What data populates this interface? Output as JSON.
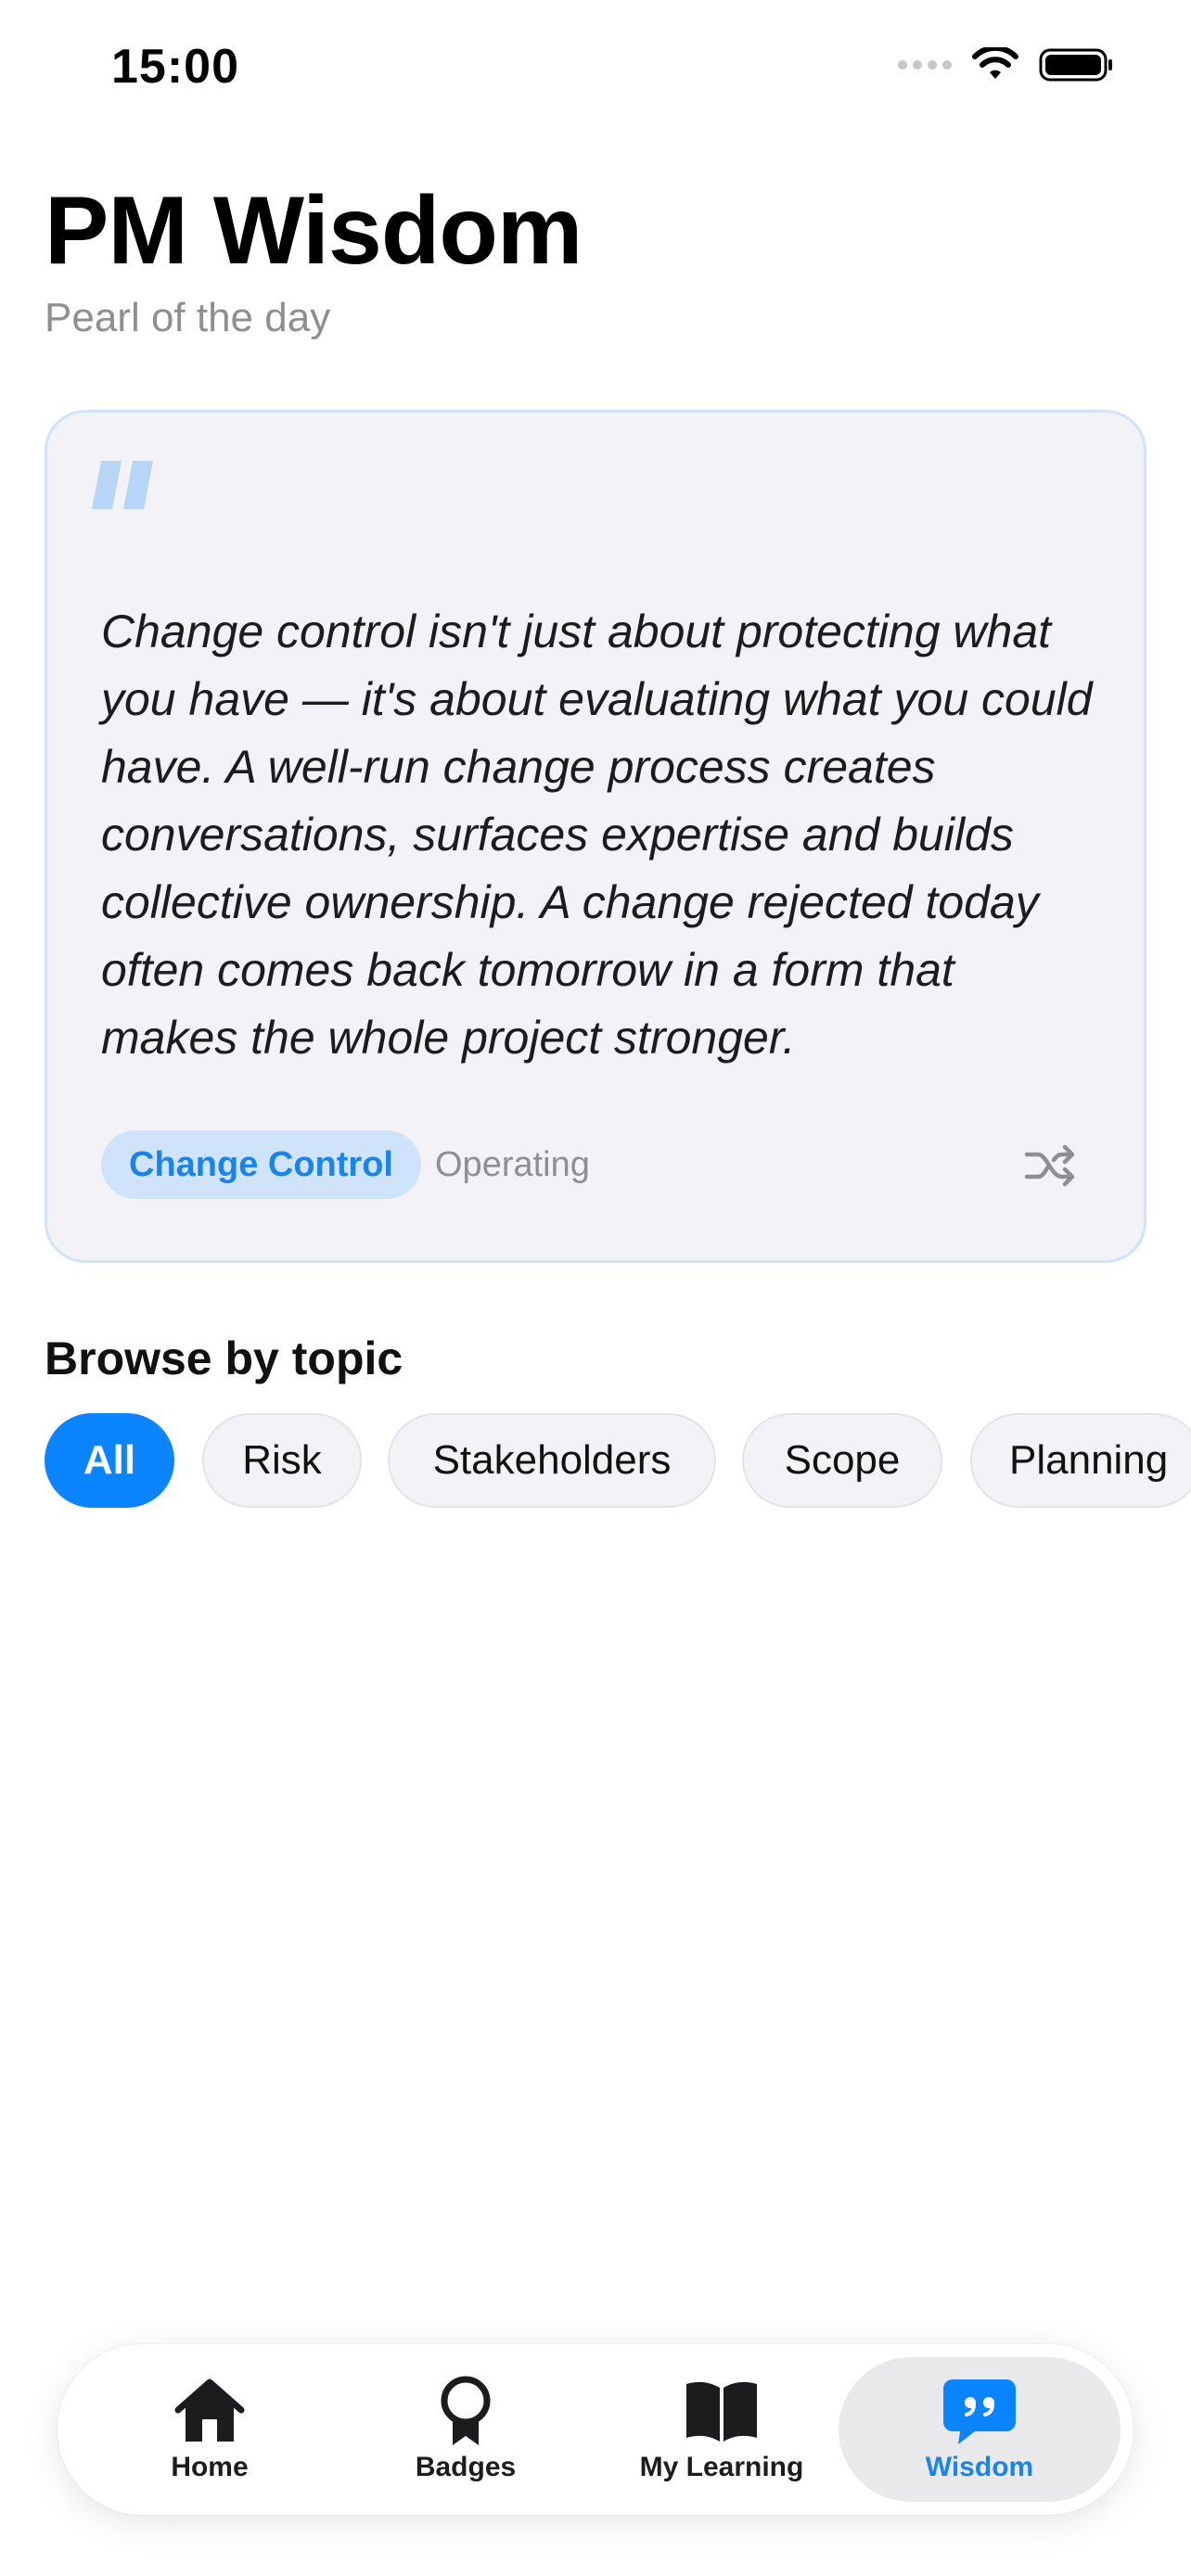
{
  "status_bar": {
    "time": "15:00"
  },
  "header": {
    "title": "PM Wisdom",
    "subtitle": "Pearl of the day"
  },
  "quote_card": {
    "text": "Change control isn't just about protecting what you have — it's about evaluating what you could have. A well-run change process creates conversations, surfaces expertise and builds collective ownership. A change rejected today often comes back tomorrow in a form that makes the whole project stronger.",
    "topic": "Change Control",
    "category": "Operating",
    "accent_color": "#1a84e8",
    "quote_icon": "quote-mark-icon",
    "action_icon": "shuffle-icon"
  },
  "browse": {
    "title": "Browse by topic",
    "chips": [
      {
        "label": "All",
        "selected": true
      },
      {
        "label": "Risk",
        "selected": false
      },
      {
        "label": "Stakeholders",
        "selected": false
      },
      {
        "label": "Scope",
        "selected": false
      },
      {
        "label": "Planning",
        "selected": false
      }
    ]
  },
  "tab_bar": {
    "active_color": "#0a84ff",
    "tabs": [
      {
        "label": "Home",
        "icon": "house-icon",
        "active": false
      },
      {
        "label": "Badges",
        "icon": "ribbon-badge-icon",
        "active": false
      },
      {
        "label": "My Learning",
        "icon": "open-book-icon",
        "active": false
      },
      {
        "label": "Wisdom",
        "icon": "quote-bubble-icon",
        "active": true
      }
    ]
  }
}
